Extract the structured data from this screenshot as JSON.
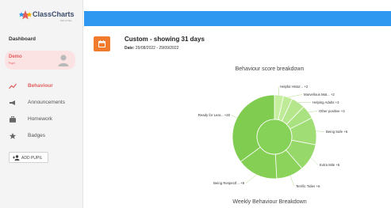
{
  "app": {
    "logo_text": "ClassCharts",
    "logo_sub": "Part of Tes"
  },
  "sidebar": {
    "dashboard_label": "Dashboard",
    "pupil": {
      "name": "Demo",
      "sub": "Pupil"
    },
    "items": [
      {
        "label": "Behaviour",
        "icon": "chart-line-icon",
        "active": true
      },
      {
        "label": "Announcements",
        "icon": "megaphone-icon",
        "active": false
      },
      {
        "label": "Homework",
        "icon": "briefcase-icon",
        "active": false
      },
      {
        "label": "Badges",
        "icon": "star-icon",
        "active": false
      }
    ],
    "add_pupil_label": "ADD PUPIL"
  },
  "header": {
    "range_title": "Custom - showing 31 days",
    "date_label": "Date:",
    "date_value": "29/08/2022 - 29/09/2022"
  },
  "colors": {
    "accent_blue": "#2e98f0",
    "accent_orange": "#f07b2c",
    "active_red": "#e35d5d",
    "chart_green": "#8cd35c"
  },
  "chart_data": {
    "type": "pie",
    "title": "Behaviour score breakdown",
    "slices": [
      {
        "label": "Helpful Histor... +2",
        "value": 2
      },
      {
        "label": "Marvellous Mat... +2",
        "value": 2
      },
      {
        "label": "Helping Adults +3",
        "value": 3
      },
      {
        "label": "Other positive +3",
        "value": 3
      },
      {
        "label": "Being Safe +6",
        "value": 6
      },
      {
        "label": "Extra Mile +6",
        "value": 6
      },
      {
        "label": "Terrific Tidier +6",
        "value": 6
      },
      {
        "label": "Being Respectf... +9",
        "value": 9
      },
      {
        "label": "Ready for Lear... +20",
        "value": 20
      }
    ]
  },
  "weekly_title": "Weekly Behaviour Breakdown"
}
